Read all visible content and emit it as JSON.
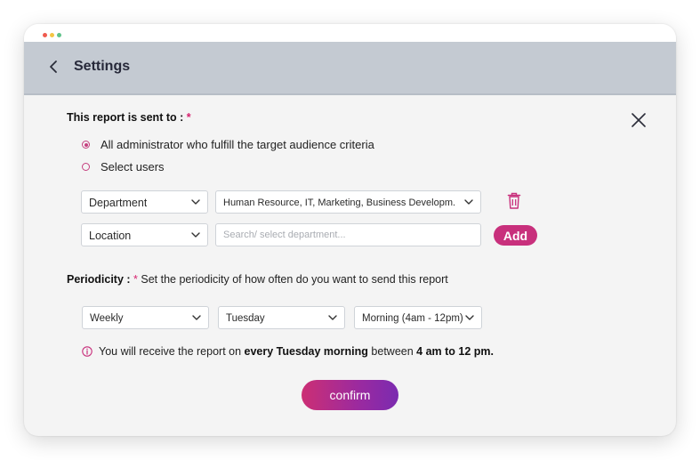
{
  "window": {
    "controls": [
      "close-dot",
      "minimize-dot",
      "maximize-dot"
    ],
    "colors": {
      "close": "#ef5b4f",
      "minimize": "#f4c544",
      "maximize": "#5fc38a"
    }
  },
  "header": {
    "back_icon": "chevron-left-icon",
    "title": "Settings",
    "background": "#c4cad2"
  },
  "close_icon": "close-icon",
  "recipients": {
    "label": "This report is sent to :",
    "required_mark": "*",
    "options": [
      {
        "label": "All administrator who fulfill the target audience criteria",
        "checked": true
      },
      {
        "label": "Select users",
        "checked": false
      }
    ]
  },
  "filters": [
    {
      "field": "Department",
      "value": "Human Resource, IT, Marketing, Business Developm...",
      "action_icon": "trash-icon"
    },
    {
      "field": "Location",
      "placeholder": "Search/ select department...",
      "action_label": "Add"
    }
  ],
  "periodicity": {
    "label": "Periodicity :",
    "required_mark": "*",
    "description": "Set the periodicity of how often do you want to send this report",
    "frequency": "Weekly",
    "day": "Tuesday",
    "time": "Morning (4am - 12pm)"
  },
  "info": {
    "icon": "info-icon",
    "prefix": "You will receive the report on ",
    "highlight_1": "every Tuesday morning",
    "middle": " between ",
    "highlight_2": "4 am to 12 pm."
  },
  "confirm_label": "confirm",
  "colors": {
    "accent": "#c8307c",
    "confirm_gradient_start": "#cc2f74",
    "confirm_gradient_end": "#7b2bb0",
    "required": "#d7226f"
  }
}
